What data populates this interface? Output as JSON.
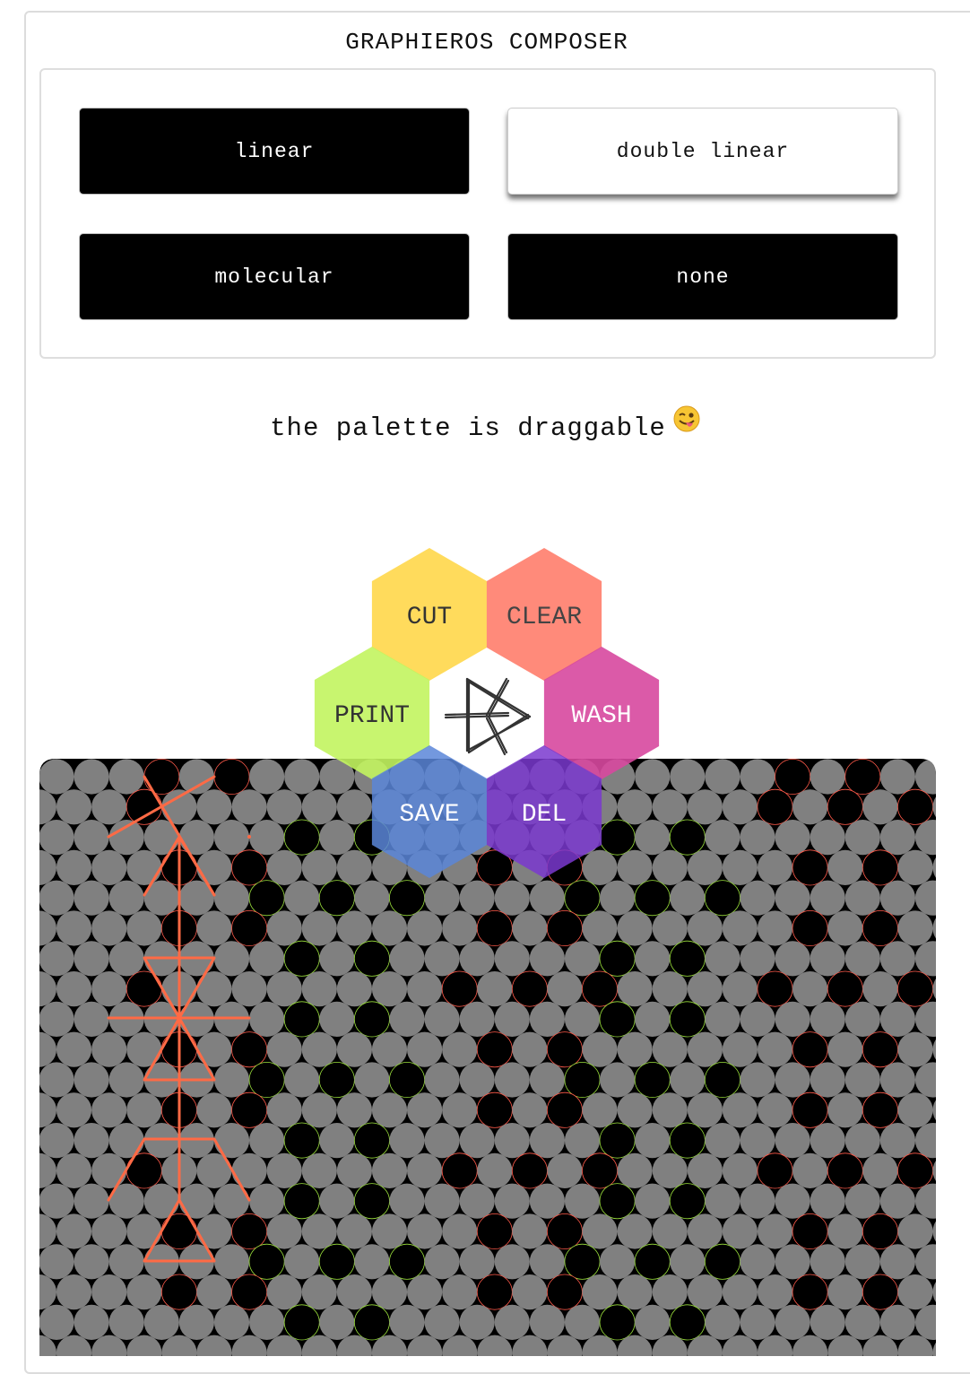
{
  "app": {
    "title": "GRAPHIEROS COMPOSER"
  },
  "modes": {
    "items": [
      {
        "label": "linear",
        "active": false
      },
      {
        "label": "double linear",
        "active": true
      },
      {
        "label": "molecular",
        "active": false
      },
      {
        "label": "none",
        "active": false
      }
    ]
  },
  "hint": {
    "text": "the palette is draggable",
    "emoji_icon": "winking-face-with-tongue-icon"
  },
  "palette": {
    "buttons": [
      {
        "label": "CUT",
        "color": "#ffdb5c"
      },
      {
        "label": "CLEAR",
        "color": "#ff8a7a"
      },
      {
        "label": "PRINT",
        "color": "#c2f45f"
      },
      {
        "label": "WASH",
        "color": "#d7489f"
      },
      {
        "label": "SAVE",
        "color": "#5a86d8"
      },
      {
        "label": "DEL",
        "color": "#7a38cf"
      }
    ],
    "center_icon": "graphieros-logo-icon"
  },
  "canvas": {
    "background": "#000000",
    "cell_color": "#808080",
    "active_cell_color": "#000000",
    "red_ring": "#ff5a4a",
    "green_ring": "#9be03c",
    "glyph_color": "#ff6a45"
  }
}
